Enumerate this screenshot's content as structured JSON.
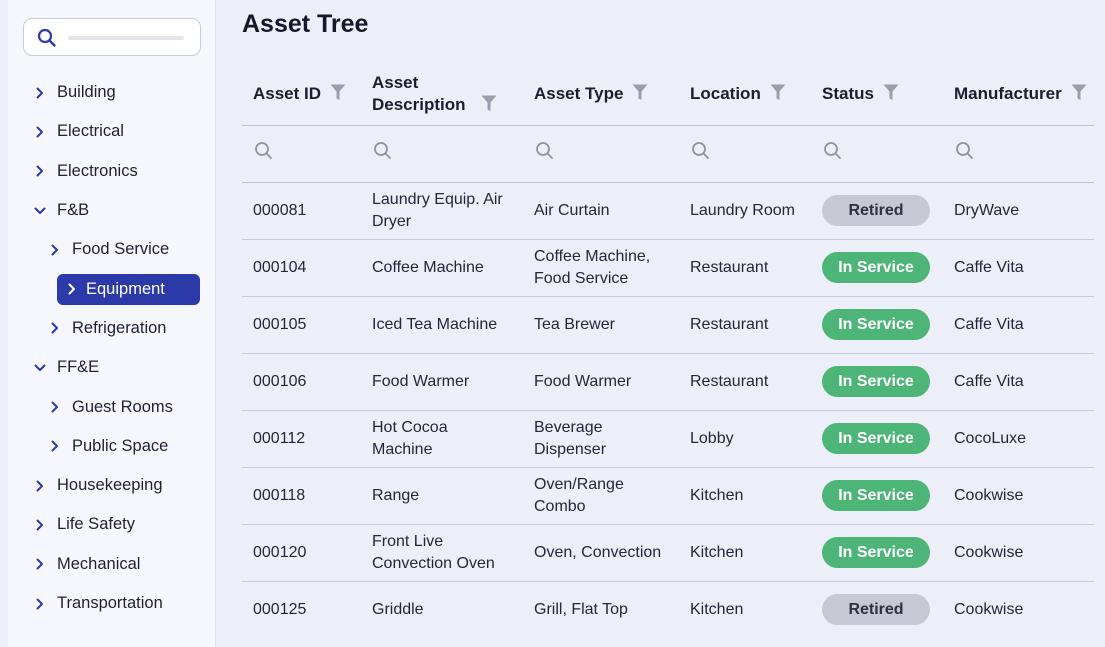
{
  "sidebar": {
    "search_placeholder": "",
    "items": [
      {
        "label": "Building",
        "level": 0,
        "expanded": false
      },
      {
        "label": "Electrical",
        "level": 0,
        "expanded": false
      },
      {
        "label": "Electronics",
        "level": 0,
        "expanded": false
      },
      {
        "label": "F&B",
        "level": 0,
        "expanded": true
      },
      {
        "label": "Food Service",
        "level": 1,
        "expanded": false
      },
      {
        "label": "Equipment",
        "level": 2,
        "expanded": false,
        "active": true
      },
      {
        "label": "Refrigeration",
        "level": 1,
        "expanded": false
      },
      {
        "label": "FF&E",
        "level": 0,
        "expanded": true
      },
      {
        "label": "Guest Rooms",
        "level": 1,
        "expanded": false
      },
      {
        "label": "Public Space",
        "level": 1,
        "expanded": false
      },
      {
        "label": "Housekeeping",
        "level": 0,
        "expanded": false
      },
      {
        "label": "Life Safety",
        "level": 0,
        "expanded": false
      },
      {
        "label": "Mechanical",
        "level": 0,
        "expanded": false
      },
      {
        "label": "Transportation",
        "level": 0,
        "expanded": false
      }
    ]
  },
  "main": {
    "title": "Asset Tree",
    "columns": [
      "Asset ID",
      "Asset Description",
      "Asset Type",
      "Location",
      "Status",
      "Manufacturer"
    ],
    "rows": [
      {
        "id": "000081",
        "description": "Laundry Equip. Air Dryer",
        "type": "Air Curtain",
        "location": "Laundry Room",
        "status": "Retired",
        "manufacturer": "DryWave"
      },
      {
        "id": "000104",
        "description": "Coffee Machine",
        "type": "Coffee Machine, Food Service",
        "location": "Restaurant",
        "status": "In Service",
        "manufacturer": "Caffe Vita"
      },
      {
        "id": "000105",
        "description": "Iced Tea Machine",
        "type": "Tea Brewer",
        "location": "Restaurant",
        "status": "In Service",
        "manufacturer": "Caffe Vita"
      },
      {
        "id": "000106",
        "description": "Food Warmer",
        "type": "Food Warmer",
        "location": "Restaurant",
        "status": "In Service",
        "manufacturer": "Caffe Vita"
      },
      {
        "id": "000112",
        "description": "Hot Cocoa Machine",
        "type": "Beverage Dispenser",
        "location": "Lobby",
        "status": "In Service",
        "manufacturer": "CocoLuxe"
      },
      {
        "id": "000118",
        "description": "Range",
        "type": "Oven/Range Combo",
        "location": "Kitchen",
        "status": "In Service",
        "manufacturer": "Cookwise"
      },
      {
        "id": "000120",
        "description": "Front Live Convection Oven",
        "type": "Oven, Convection",
        "location": "Kitchen",
        "status": "In Service",
        "manufacturer": "Cookwise"
      },
      {
        "id": "000125",
        "description": "Griddle",
        "type": "Grill, Flat Top",
        "location": "Kitchen",
        "status": "Retired",
        "manufacturer": "Cookwise"
      }
    ]
  },
  "colors": {
    "accent": "#2b3aa8",
    "in_service": "#4cb577",
    "retired": "#c6c9d3"
  },
  "icons": {
    "search": "search-icon",
    "filter": "filter-icon",
    "chevron_right": "chevron-right-icon",
    "chevron_down": "chevron-down-icon"
  }
}
